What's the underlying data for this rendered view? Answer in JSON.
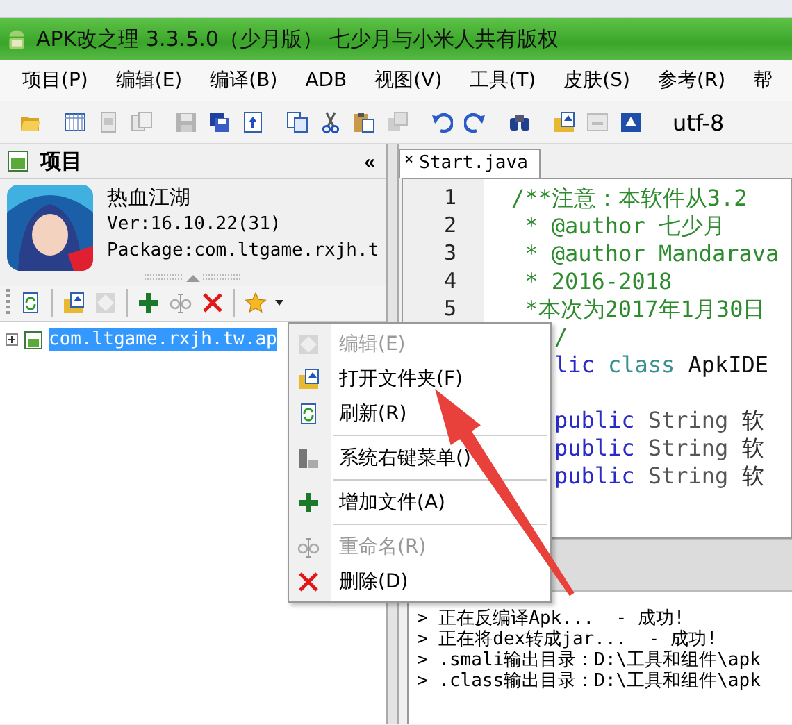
{
  "window": {
    "title": "APK改之理 3.3.5.0（少月版） 七少月与小米人共有版权"
  },
  "menu_bar": [
    "项目(P)",
    "编辑(E)",
    "编译(B)",
    "ADB",
    "视图(V)",
    "工具(T)",
    "皮肤(S)",
    "参考(R)",
    "帮"
  ],
  "toolbar": {
    "buttons": [
      {
        "kind": "open-folder",
        "disabled": false
      },
      {
        "kind": "separator"
      },
      {
        "kind": "grid-doc",
        "disabled": false
      },
      {
        "kind": "page",
        "disabled": true
      },
      {
        "kind": "pages",
        "disabled": true
      },
      {
        "kind": "separator"
      },
      {
        "kind": "save",
        "disabled": true
      },
      {
        "kind": "save-all",
        "disabled": false
      },
      {
        "kind": "doc-arrow",
        "disabled": false
      },
      {
        "kind": "separator"
      },
      {
        "kind": "copy",
        "disabled": false
      },
      {
        "kind": "cut",
        "disabled": false
      },
      {
        "kind": "paste",
        "disabled": false
      },
      {
        "kind": "multi",
        "disabled": true
      },
      {
        "kind": "separator"
      },
      {
        "kind": "undo",
        "disabled": false
      },
      {
        "kind": "redo",
        "disabled": false
      },
      {
        "kind": "separator"
      },
      {
        "kind": "binoculars",
        "disabled": false
      },
      {
        "kind": "separator"
      },
      {
        "kind": "folder-up",
        "disabled": false
      },
      {
        "kind": "tray",
        "disabled": true
      },
      {
        "kind": "window-arrow",
        "disabled": false
      },
      {
        "kind": "separator"
      }
    ],
    "encoding": "utf-8"
  },
  "project_panel": {
    "title": "项目",
    "collapse": "«",
    "app": {
      "name": "热血江湖",
      "version": "Ver:16.10.22(31)",
      "package": "Package:com.ltgame.rxjh.t"
    },
    "toolbar": [
      {
        "kind": "refresh",
        "disabled": false
      },
      {
        "kind": "separator"
      },
      {
        "kind": "folder-up",
        "disabled": false
      },
      {
        "kind": "diamond",
        "disabled": true
      },
      {
        "kind": "separator"
      },
      {
        "kind": "plus",
        "disabled": false
      },
      {
        "kind": "rename",
        "disabled": true
      },
      {
        "kind": "delete",
        "disabled": false
      },
      {
        "kind": "separator"
      },
      {
        "kind": "star",
        "disabled": false
      }
    ],
    "tree": [
      {
        "label": "com.ltgame.rxjh.tw.ap",
        "expanded": false,
        "selected": true
      }
    ]
  },
  "editor": {
    "tabs": [
      {
        "label": "Start.java",
        "close": "×",
        "selected": true
      }
    ],
    "line_numbers": [
      "1",
      "2",
      "3",
      "4",
      "5"
    ],
    "lines": [
      {
        "kind": "code",
        "segments": [
          {
            "kind": "comment",
            "text": "/**注意：本软件从3.2"
          }
        ]
      },
      {
        "kind": "code",
        "segments": [
          {
            "kind": "comment",
            "text": " * @author 七少月"
          }
        ]
      },
      {
        "kind": "code",
        "segments": [
          {
            "kind": "comment",
            "text": " * @author Mandarava"
          }
        ]
      },
      {
        "kind": "code",
        "segments": [
          {
            "kind": "comment",
            "text": " * 2016-2018"
          }
        ]
      },
      {
        "kind": "code",
        "segments": [
          {
            "kind": "comment",
            "text": " *本次为2017年1月30日"
          }
        ]
      },
      {
        "kind": "partial",
        "segments": [
          {
            "kind": "comment",
            "text": "/"
          }
        ]
      },
      {
        "kind": "partial",
        "segments": [
          {
            "kind": "keyword",
            "text": "lic"
          },
          {
            "kind": "class",
            "text": "class"
          },
          {
            "kind": "name",
            "text": "ApkIDE"
          }
        ]
      },
      {
        "kind": "blank"
      },
      {
        "kind": "partial",
        "segments": [
          {
            "kind": "keyword",
            "text": "public"
          },
          {
            "kind": "type",
            "text": "String"
          },
          {
            "kind": "plain",
            "text": "软"
          }
        ]
      },
      {
        "kind": "partial",
        "segments": [
          {
            "kind": "keyword",
            "text": "public"
          },
          {
            "kind": "type",
            "text": "String"
          },
          {
            "kind": "plain",
            "text": "软"
          }
        ]
      },
      {
        "kind": "partial",
        "segments": [
          {
            "kind": "keyword",
            "text": "public"
          },
          {
            "kind": "type",
            "text": "String"
          },
          {
            "kind": "plain",
            "text": "软"
          }
        ]
      }
    ]
  },
  "output": {
    "lines": [
      "> 正在反编译Apk...  - 成功!",
      "> 正在将dex转成jar...  - 成功!",
      "> .smali输出目录：D:\\工具和组件\\apk",
      "> .class输出目录：D:\\工具和组件\\apk"
    ]
  },
  "context_menu": [
    {
      "kind": "diamond",
      "label": "编辑(E)",
      "disabled": true
    },
    {
      "kind": "folder-up",
      "label": "打开文件夹(F)",
      "disabled": false
    },
    {
      "kind": "refresh",
      "label": "刷新(R)",
      "disabled": false
    },
    {
      "kind": "separator"
    },
    {
      "kind": "computer",
      "label": "系统右键菜单()",
      "disabled": false
    },
    {
      "kind": "separator"
    },
    {
      "kind": "plus",
      "label": "增加文件(A)",
      "disabled": false
    },
    {
      "kind": "separator"
    },
    {
      "kind": "rename",
      "label": "重命名(R)",
      "disabled": true
    },
    {
      "kind": "delete",
      "label": "删除(D)",
      "disabled": false
    }
  ]
}
